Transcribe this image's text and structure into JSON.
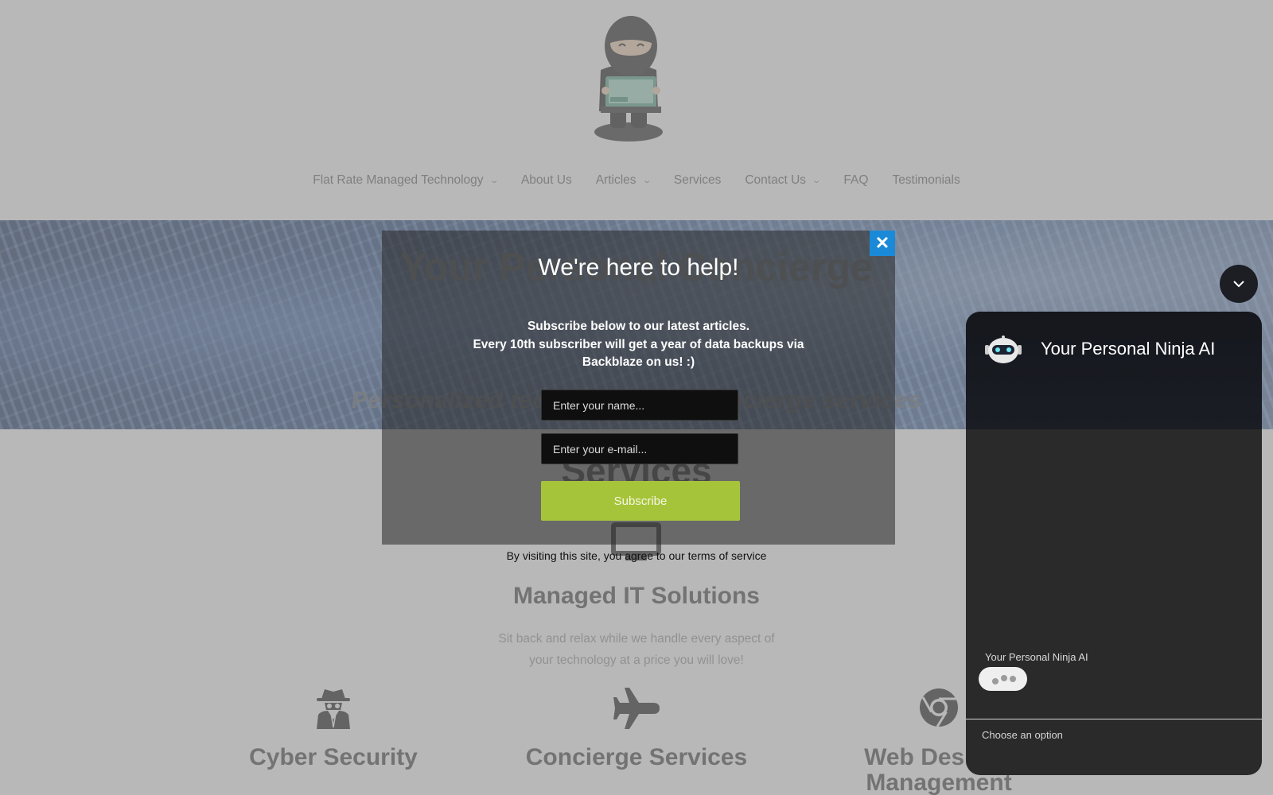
{
  "nav": {
    "items": [
      {
        "label": "Flat Rate Managed Technology",
        "has_dropdown": true
      },
      {
        "label": "About Us",
        "has_dropdown": false
      },
      {
        "label": "Articles",
        "has_dropdown": true
      },
      {
        "label": "Services",
        "has_dropdown": false
      },
      {
        "label": "Contact Us",
        "has_dropdown": true
      },
      {
        "label": "FAQ",
        "has_dropdown": false
      },
      {
        "label": "Testimonials",
        "has_dropdown": false
      }
    ],
    "chevron": "⌄"
  },
  "hero": {
    "title": "Your Personal Concierge",
    "subtitle": "Personalized technology and concierge services"
  },
  "services": {
    "heading": "Services",
    "managed_title": "Managed IT Solutions",
    "managed_desc": "Sit back and relax while we handle every aspect of your technology at a price you will love!",
    "columns": [
      {
        "name": "Cyber Security",
        "icon": "spy-icon"
      },
      {
        "name": "Concierge Services",
        "icon": "plane-icon"
      },
      {
        "name": "Web Design / Management",
        "icon": "chrome-icon"
      }
    ]
  },
  "popup": {
    "title": "We're here to help!",
    "line1": "Subscribe below to our latest articles.",
    "line2": "Every 10th subscriber will get a year of data backups via Backblaze on us! :)",
    "name_placeholder": "Enter your name...",
    "email_placeholder": "Enter your e-mail...",
    "subscribe_label": "Subscribe",
    "close_label": "✕",
    "terms": "By visiting this site, you agree to our terms of service",
    "colors": {
      "subscribe": "#a6c43a",
      "close": "#1a8ad8"
    }
  },
  "chat": {
    "title": "Your Personal Ninja AI",
    "sender": "Your Personal Ninja AI",
    "input_placeholder": "Choose an option"
  }
}
